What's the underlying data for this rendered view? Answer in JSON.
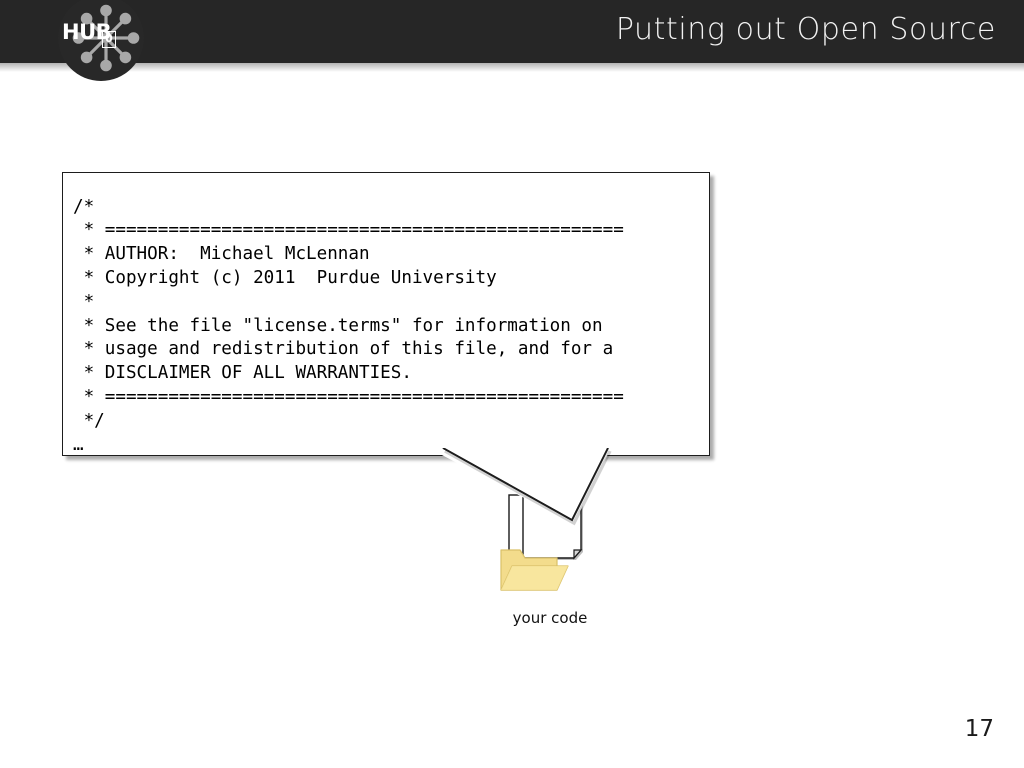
{
  "slide": {
    "title": "Putting out Open Source",
    "page_number": "17",
    "background_color": "#ffffff"
  },
  "header": {
    "background_color": "#262626",
    "title": "Putting out Open Source",
    "logo": {
      "wordmark": "HUB",
      "badge": "0",
      "icon_name": "hub-radial-nodes-icon",
      "circle_color": "#282828",
      "node_color": "#a8a8a8"
    }
  },
  "callout": {
    "border_color": "#1d1d1d",
    "fill_color": "#ffffff",
    "code_lines": [
      "/*",
      " * =================================================",
      " * AUTHOR:  Michael McLennan",
      " * Copyright (c) 2011  Purdue University",
      " *",
      " * See the file \"license.terms\" for information on",
      " * usage and redistribution of this file, and for a",
      " * DISCLAIMER OF ALL WARRANTIES.",
      " * =================================================",
      " */",
      "…"
    ],
    "code_text": "/*\n * =================================================\n * AUTHOR:  Michael McLennan\n * Copyright (c) 2011  Purdue University\n *\n * See the file \"license.terms\" for information on\n * usage and redistribution of this file, and for a\n * DISCLAIMER OF ALL WARRANTIES.\n * =================================================\n */\n…"
  },
  "code_icon": {
    "caption": "your code",
    "document_icon_name": "documents-pages-icon",
    "folder_icon_name": "open-folder-icon",
    "folder_color": "#f7e08a",
    "folder_shade_color": "#e8d27a",
    "page_color": "#ffffff"
  }
}
